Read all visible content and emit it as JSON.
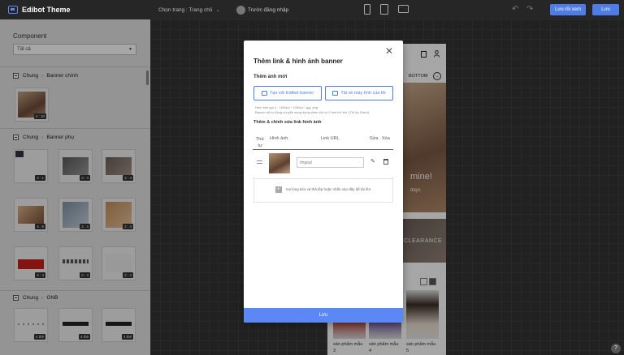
{
  "app": {
    "title": "Edibot Theme",
    "brand_color": "#4f7de8"
  },
  "topbar": {
    "page_label": "Chọn trang : Trang chủ",
    "toggle_label": "Trước đăng nhập",
    "preview_button": "Lưu rồi xem",
    "save_button": "Lưu"
  },
  "sidebar": {
    "title": "Component",
    "filter_value": "Tất cả",
    "groups": [
      {
        "parent": "Chung",
        "name": "Banner chính"
      },
      {
        "parent": "Chung",
        "name": "Banner phụ"
      },
      {
        "parent": "Chung",
        "name": "GNB"
      }
    ],
    "badges": {
      "main": "4 : 10",
      "sub": [
        "4 : 1",
        "2 : 4",
        "2 : 4",
        "4 : 6",
        "2 : 4",
        "2 : 4",
        "4 : 4",
        "2 : 4",
        "2 : 4"
      ],
      "gnb": [
        "4 thẻ",
        "4 thẻ",
        "4 thẻ"
      ]
    }
  },
  "preview": {
    "nav_item": "BOTTOM",
    "hero_text": "mine!",
    "hero_sub": "days",
    "banner_text": "CLEARANCE",
    "product_label": "sản phẩm mẫu",
    "product_numbers": [
      "3",
      "4",
      "5"
    ]
  },
  "modal": {
    "title": "Thêm link & hình ảnh banner",
    "section_new": "Thêm ảnh mới",
    "btn_create": "Tạo với Edibot banner",
    "btn_upload": "Tải về máy tính của tôi",
    "hint1": "Hình ảnh gợi ý : 1600px * 1000px / jpg, png",
    "hint2": "Banner sẽ tự động chuyển sang dạng slider khi có 2 ảnh trở lên. (Tối đa 6 ảnh)",
    "section_edit": "Thêm & chỉnh sửa link hình ảnh",
    "columns": {
      "order": "Thứ tự",
      "image": "Hình ảnh",
      "url": "Link URL",
      "edit": "Sửa",
      "delete": "Xóa"
    },
    "url_placeholder": "/mypu/",
    "dropzone": "Vui lòng kéo và thả tệp hoặc nhấn vào đây để tải lên.",
    "save": "Lưu"
  },
  "help": "?"
}
